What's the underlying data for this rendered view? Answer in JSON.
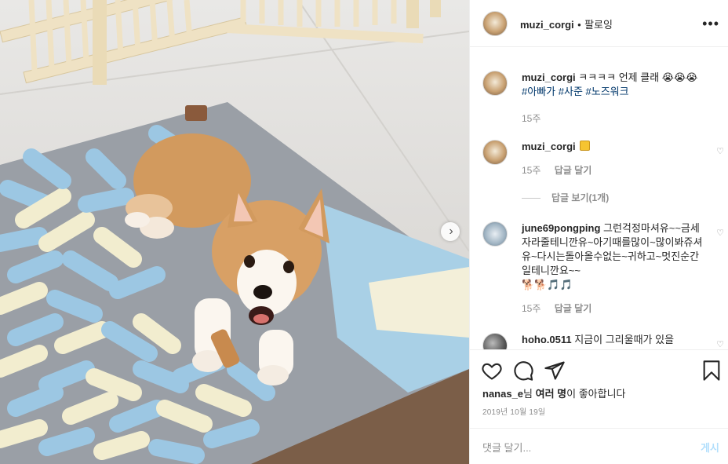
{
  "post": {
    "username": "muzi_corgi",
    "separator": "•",
    "follow_label": "팔로잉",
    "more_icon": "more-horizontal-icon"
  },
  "caption": {
    "username": "muzi_corgi",
    "text": "ㅋㅋㅋㅋ 언제 클래",
    "emojis": "😭😭😭",
    "hashtags": [
      "#아빠가",
      "#사준",
      "#노즈워크"
    ],
    "time": "15주"
  },
  "comments": [
    {
      "username": "muzi_corgi",
      "text": "",
      "badge_icon": "yellow-square-emoji",
      "time": "15주",
      "reply_label": "답글 달기",
      "view_replies_label": "답글 보기(1개)"
    },
    {
      "username": "june69pongping",
      "text": "그런걱정마셔유~~금세자라줄테니깐유~아기때를많이~많이봐쥬셔유~다시는돌아올수없는~귀하고~멋진순간일테니깐요~~",
      "emojis": "🐕🐕🎵🎵",
      "time": "15주",
      "reply_label": "답글 달기"
    },
    {
      "username": "hoho.0511",
      "text": "지금이 그리울때가 있을"
    }
  ],
  "actions": {
    "like_icon": "heart-icon",
    "comment_icon": "comment-icon",
    "share_icon": "send-icon",
    "save_icon": "bookmark-icon"
  },
  "likes": {
    "user": "nanas_e",
    "middle": "님 ",
    "others": "여러 명",
    "suffix": "이 좋아합니다"
  },
  "date": "2019년 10월 19일",
  "comment_input": {
    "placeholder": "댓글 달기...",
    "post_label": "게시"
  },
  "colors": {
    "hashtag": "#00376b",
    "secondary_text": "#8e8e8e",
    "post_button_disabled": "#b2dffc"
  }
}
